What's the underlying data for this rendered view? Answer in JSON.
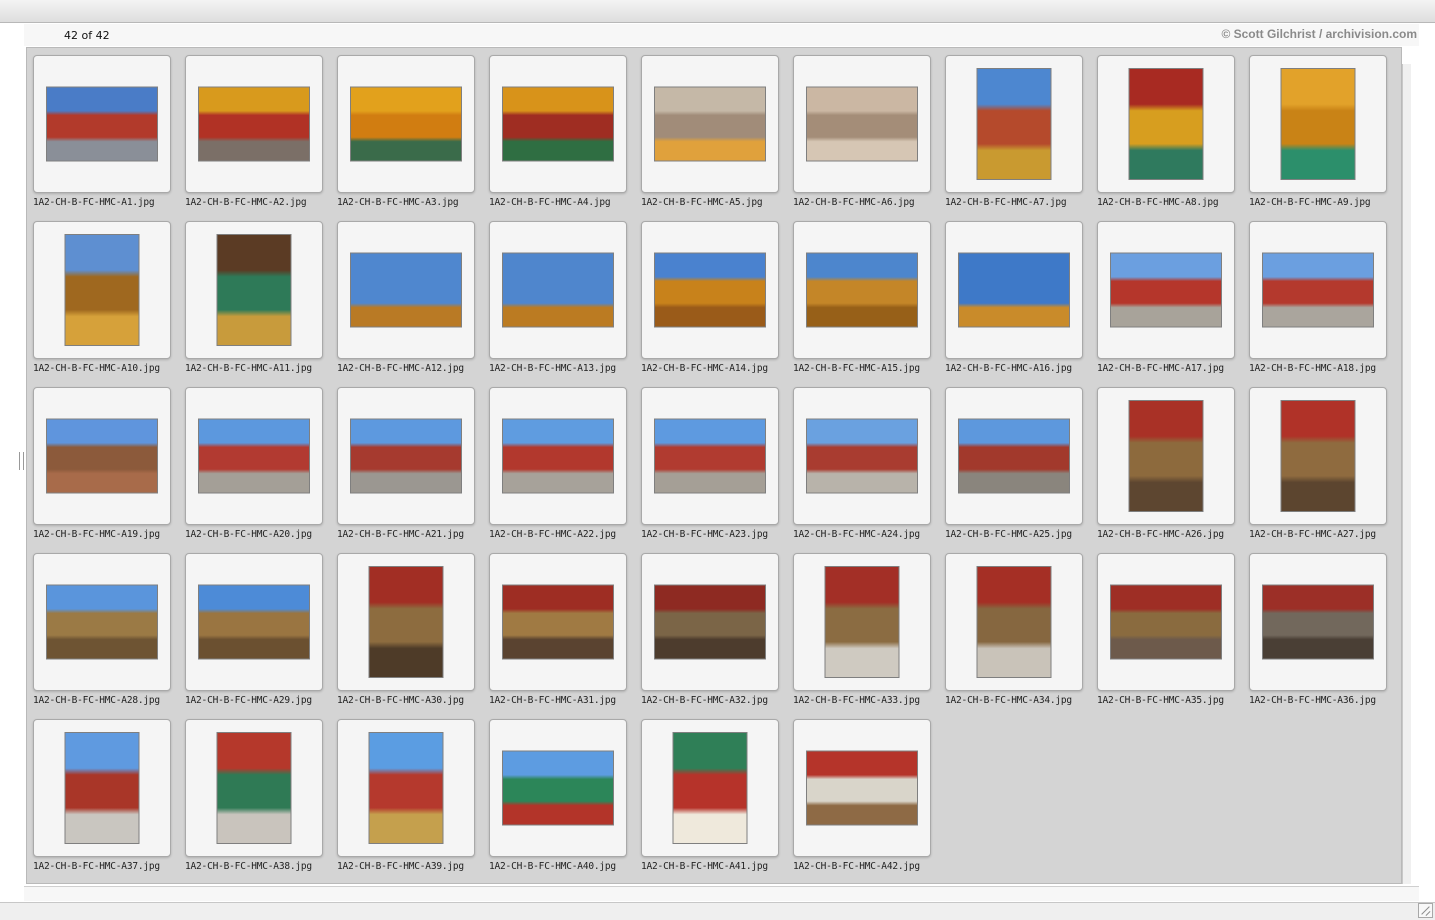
{
  "header": {
    "counter": "42 of 42",
    "credit": "© Scott Gilchrist / archivision.com"
  },
  "images": [
    {
      "name": "1A2-CH-B-FC-HMC-A1.jpg",
      "orientation": "land",
      "palette": [
        "#4a7cc7",
        "#b23a2b",
        "#8a8f98"
      ]
    },
    {
      "name": "1A2-CH-B-FC-HMC-A2.jpg",
      "orientation": "land",
      "palette": [
        "#d89a1d",
        "#b13225",
        "#7b6f67"
      ]
    },
    {
      "name": "1A2-CH-B-FC-HMC-A3.jpg",
      "orientation": "land",
      "palette": [
        "#e2a11c",
        "#d17d11",
        "#3a6b4a"
      ]
    },
    {
      "name": "1A2-CH-B-FC-HMC-A4.jpg",
      "orientation": "land",
      "palette": [
        "#d8931a",
        "#9f2d22",
        "#2f6e42"
      ]
    },
    {
      "name": "1A2-CH-B-FC-HMC-A5.jpg",
      "orientation": "land",
      "palette": [
        "#c5b8a7",
        "#a18c79",
        "#e0a13c"
      ]
    },
    {
      "name": "1A2-CH-B-FC-HMC-A6.jpg",
      "orientation": "land",
      "palette": [
        "#cbb7a3",
        "#a48d78",
        "#d6c6b4"
      ]
    },
    {
      "name": "1A2-CH-B-FC-HMC-A7.jpg",
      "orientation": "port",
      "palette": [
        "#4d87d0",
        "#b54a2c",
        "#c99a30"
      ]
    },
    {
      "name": "1A2-CH-B-FC-HMC-A8.jpg",
      "orientation": "port",
      "palette": [
        "#a82a22",
        "#d79e1f",
        "#2f7a5e"
      ]
    },
    {
      "name": "1A2-CH-B-FC-HMC-A9.jpg",
      "orientation": "port",
      "palette": [
        "#e2a22a",
        "#c98316",
        "#2c8f6b"
      ]
    },
    {
      "name": "1A2-CH-B-FC-HMC-A10.jpg",
      "orientation": "port",
      "palette": [
        "#5e8fd1",
        "#9f681f",
        "#d6a13a"
      ]
    },
    {
      "name": "1A2-CH-B-FC-HMC-A11.jpg",
      "orientation": "port",
      "palette": [
        "#5b3b24",
        "#2e7a58",
        "#c89b3c"
      ]
    },
    {
      "name": "1A2-CH-B-FC-HMC-A12.jpg",
      "orientation": "land",
      "palette": [
        "#4f87cf",
        "#4f87cf",
        "#b97a25"
      ]
    },
    {
      "name": "1A2-CH-B-FC-HMC-A13.jpg",
      "orientation": "land",
      "palette": [
        "#4f86cd",
        "#4f86cd",
        "#bb7b22"
      ]
    },
    {
      "name": "1A2-CH-B-FC-HMC-A14.jpg",
      "orientation": "land",
      "palette": [
        "#4a82cf",
        "#c8821b",
        "#9a5b19"
      ]
    },
    {
      "name": "1A2-CH-B-FC-HMC-A15.jpg",
      "orientation": "land",
      "palette": [
        "#4d86cd",
        "#c48628",
        "#976018"
      ]
    },
    {
      "name": "1A2-CH-B-FC-HMC-A16.jpg",
      "orientation": "land",
      "palette": [
        "#3e79c8",
        "#3e79c8",
        "#c98b2a"
      ]
    },
    {
      "name": "1A2-CH-B-FC-HMC-A17.jpg",
      "orientation": "land",
      "palette": [
        "#6b9fe0",
        "#b5362b",
        "#a8a39a"
      ]
    },
    {
      "name": "1A2-CH-B-FC-HMC-A18.jpg",
      "orientation": "land",
      "palette": [
        "#6b9fe0",
        "#b4392d",
        "#aaa59d"
      ]
    },
    {
      "name": "1A2-CH-B-FC-HMC-A19.jpg",
      "orientation": "land",
      "palette": [
        "#5f95dd",
        "#8c5a3b",
        "#a86b4a"
      ]
    },
    {
      "name": "1A2-CH-B-FC-HMC-A20.jpg",
      "orientation": "land",
      "palette": [
        "#5c98de",
        "#b23a31",
        "#a49f97"
      ]
    },
    {
      "name": "1A2-CH-B-FC-HMC-A21.jpg",
      "orientation": "land",
      "palette": [
        "#5d99df",
        "#a63a2f",
        "#9b9791"
      ]
    },
    {
      "name": "1A2-CH-B-FC-HMC-A22.jpg",
      "orientation": "land",
      "palette": [
        "#5f9ce0",
        "#b2382d",
        "#a7a29a"
      ]
    },
    {
      "name": "1A2-CH-B-FC-HMC-A23.jpg",
      "orientation": "land",
      "palette": [
        "#5e9ae0",
        "#b13b30",
        "#a59f96"
      ]
    },
    {
      "name": "1A2-CH-B-FC-HMC-A24.jpg",
      "orientation": "land",
      "palette": [
        "#6aa1e0",
        "#a93c30",
        "#b8b3aa"
      ]
    },
    {
      "name": "1A2-CH-B-FC-HMC-A25.jpg",
      "orientation": "land",
      "palette": [
        "#5d98dd",
        "#a2392c",
        "#8a857d"
      ]
    },
    {
      "name": "1A2-CH-B-FC-HMC-A26.jpg",
      "orientation": "port",
      "palette": [
        "#a93126",
        "#8d6a3d",
        "#5d4630"
      ]
    },
    {
      "name": "1A2-CH-B-FC-HMC-A27.jpg",
      "orientation": "port",
      "palette": [
        "#b03228",
        "#8f6b3f",
        "#5c452f"
      ]
    },
    {
      "name": "1A2-CH-B-FC-HMC-A28.jpg",
      "orientation": "land",
      "palette": [
        "#5a95dc",
        "#9b7a45",
        "#6e5433"
      ]
    },
    {
      "name": "1A2-CH-B-FC-HMC-A29.jpg",
      "orientation": "land",
      "palette": [
        "#4d8bd7",
        "#9a7541",
        "#6b5030"
      ]
    },
    {
      "name": "1A2-CH-B-FC-HMC-A30.jpg",
      "orientation": "port",
      "palette": [
        "#a22e24",
        "#8d6c3f",
        "#4e3b28"
      ]
    },
    {
      "name": "1A2-CH-B-FC-HMC-A31.jpg",
      "orientation": "land",
      "palette": [
        "#9e2d23",
        "#a07a43",
        "#5a4330"
      ]
    },
    {
      "name": "1A2-CH-B-FC-HMC-A32.jpg",
      "orientation": "land",
      "palette": [
        "#8e2a22",
        "#7b6547",
        "#4d3c2d"
      ]
    },
    {
      "name": "1A2-CH-B-FC-HMC-A33.jpg",
      "orientation": "port",
      "palette": [
        "#a32f26",
        "#8b6c42",
        "#cfcac1"
      ]
    },
    {
      "name": "1A2-CH-B-FC-HMC-A34.jpg",
      "orientation": "port",
      "palette": [
        "#a52f25",
        "#866740",
        "#c9c3b9"
      ]
    },
    {
      "name": "1A2-CH-B-FC-HMC-A35.jpg",
      "orientation": "land",
      "palette": [
        "#9e2e25",
        "#8a6b3f",
        "#6d5a4b"
      ]
    },
    {
      "name": "1A2-CH-B-FC-HMC-A36.jpg",
      "orientation": "land",
      "palette": [
        "#9c2f27",
        "#72685c",
        "#4a3f35"
      ]
    },
    {
      "name": "1A2-CH-B-FC-HMC-A37.jpg",
      "orientation": "port",
      "palette": [
        "#5f9ae0",
        "#a93628",
        "#c9c6c0"
      ]
    },
    {
      "name": "1A2-CH-B-FC-HMC-A38.jpg",
      "orientation": "port",
      "palette": [
        "#b5382b",
        "#2f7a55",
        "#c9c4bd"
      ]
    },
    {
      "name": "1A2-CH-B-FC-HMC-A39.jpg",
      "orientation": "port",
      "palette": [
        "#5b9de2",
        "#b5392d",
        "#c5a04d"
      ]
    },
    {
      "name": "1A2-CH-B-FC-HMC-A40.jpg",
      "orientation": "land",
      "palette": [
        "#5d9ce1",
        "#2c8659",
        "#b33429"
      ]
    },
    {
      "name": "1A2-CH-B-FC-HMC-A41.jpg",
      "orientation": "port",
      "palette": [
        "#2f7f57",
        "#b6332a",
        "#efe9dc"
      ]
    },
    {
      "name": "1A2-CH-B-FC-HMC-A42.jpg",
      "orientation": "land",
      "palette": [
        "#b5342a",
        "#d9d5ca",
        "#8e6a45"
      ]
    }
  ]
}
